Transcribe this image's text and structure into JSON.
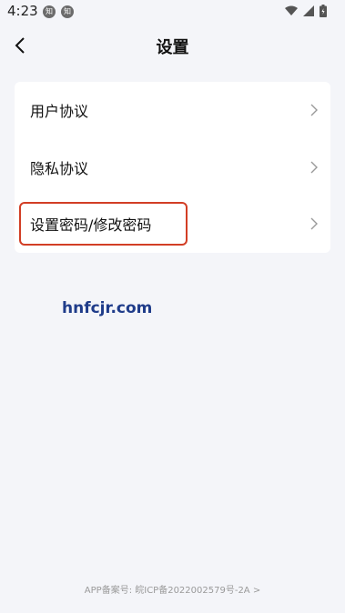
{
  "status_bar": {
    "time": "4:23",
    "app_icons": [
      "知",
      "知"
    ],
    "icons": [
      "wifi-icon",
      "signal-icon",
      "battery-icon"
    ]
  },
  "header": {
    "title": "设置",
    "back_icon": "chevron-left-icon"
  },
  "settings": {
    "items": [
      {
        "label": "用户协议"
      },
      {
        "label": "隐私协议"
      },
      {
        "label": "设置密码/修改密码"
      }
    ]
  },
  "watermark": "hnfcjr.com",
  "footer": {
    "icp": "APP备案号: 皖ICP备2022002579号-2A >"
  },
  "colors": {
    "background": "#f4f5f9",
    "card": "#ffffff",
    "highlight": "#d23e25",
    "watermark": "#1f3c8a"
  }
}
